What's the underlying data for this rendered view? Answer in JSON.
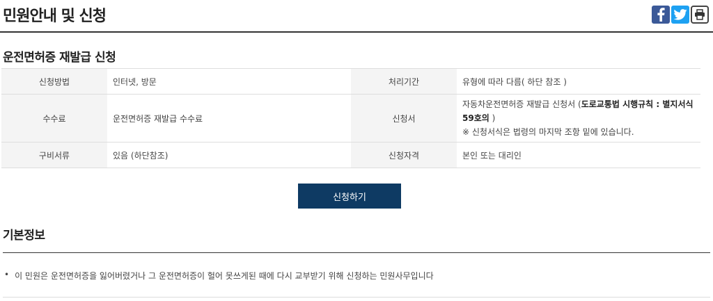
{
  "page": {
    "title": "민원안내 및 신청"
  },
  "share": {
    "facebook_icon": "facebook-icon",
    "twitter_icon": "twitter-icon",
    "print_icon": "printer-icon"
  },
  "section1": {
    "title": "운전면허증 재발급 신청",
    "rows": [
      {
        "label1": "신청방법",
        "value1": "인터넷, 방문",
        "label2": "처리기간",
        "value2": "유형에 따라 다름( 하단 참조 )"
      },
      {
        "label1": "수수료",
        "value1": "운전면허증 재발급 수수료",
        "label2": "신청서",
        "value2_prefix": "자동차운전면허증 재발급 신청서 (",
        "value2_bold": "도로교통법 시행규칙 : 별지서식 59호의",
        "value2_suffix": " )",
        "value2_note": "※ 신청서식은 법령의 마지막 조항 밑에 있습니다."
      },
      {
        "label1": "구비서류",
        "value1": "있음 (하단참조)",
        "label2": "신청자격",
        "value2": "본인 또는 대리인"
      }
    ]
  },
  "apply_button": "신청하기",
  "section2": {
    "title": "기본정보",
    "bullet": "•",
    "text": "이 민원은 운전면허증을 잃어버렸거나 그 운전면허증이 헐어 못쓰게된 때에 다시 교부받기 위해 신청하는 민원사무입니다"
  }
}
